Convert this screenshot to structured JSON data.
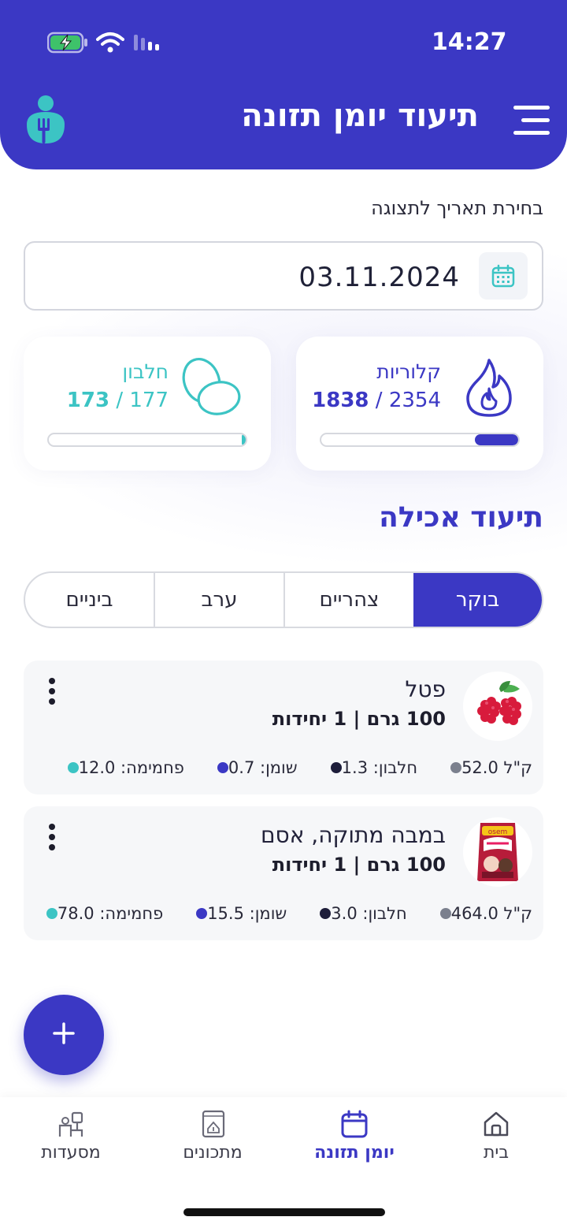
{
  "status_bar": {
    "time": "14:27"
  },
  "header": {
    "title": "תיעוד יומן תזונה",
    "menu_icon": "hamburger-icon",
    "logo_icon": "app-logo-icon"
  },
  "date_picker": {
    "label": "בחירת תאריך לתצוגה",
    "value": "03.11.2024"
  },
  "stats": {
    "calories": {
      "name": "קלוריות",
      "current": "1838",
      "separator": " / ",
      "target": "2354",
      "progress": 0.22,
      "color": "#3b38c4"
    },
    "protein": {
      "name": "חלבון",
      "current": "173",
      "separator": " / ",
      "target": "177",
      "progress": 0.02,
      "color": "#3cc4c4"
    }
  },
  "section_title": "תיעוד אכילה",
  "meal_tabs": [
    {
      "label": "בוקר",
      "active": true
    },
    {
      "label": "צהריים",
      "active": false
    },
    {
      "label": "ערב",
      "active": false
    },
    {
      "label": "ביניים",
      "active": false
    }
  ],
  "foods": [
    {
      "name": "פטל",
      "quantity": "100 גרם | 1 יחידות",
      "image": "raspberry-image",
      "nutrients": [
        {
          "text": "ק\"ל 52.0",
          "color": "#7b808e"
        },
        {
          "text": "חלבון: 1.3",
          "color": "#1d1d3a"
        },
        {
          "text": "שומן: 0.7",
          "color": "#3b38c4"
        },
        {
          "text": "פחמימה: 12.0",
          "color": "#3cc4c4"
        }
      ]
    },
    {
      "name": "במבה מתוקה, אסם",
      "quantity": "100 גרם | 1 יחידות",
      "image": "bamba-package-image",
      "nutrients": [
        {
          "text": "ק\"ל 464.0",
          "color": "#7b808e"
        },
        {
          "text": "חלבון: 3.0",
          "color": "#1d1d3a"
        },
        {
          "text": "שומן: 15.5",
          "color": "#3b38c4"
        },
        {
          "text": "פחמימה: 78.0",
          "color": "#3cc4c4"
        }
      ]
    }
  ],
  "fab": {
    "icon": "plus-icon"
  },
  "bottom_nav": [
    {
      "label": "בית",
      "icon": "home-icon",
      "active": false
    },
    {
      "label": "יומן תזונה",
      "icon": "calendar-icon",
      "active": true
    },
    {
      "label": "מתכונים",
      "icon": "recipe-book-icon",
      "active": false
    },
    {
      "label": "מסעדות",
      "icon": "restaurant-icon",
      "active": false
    }
  ],
  "colors": {
    "primary": "#3b38c4",
    "accent": "#3cc4c4",
    "card_bg": "#f6f7f9"
  }
}
